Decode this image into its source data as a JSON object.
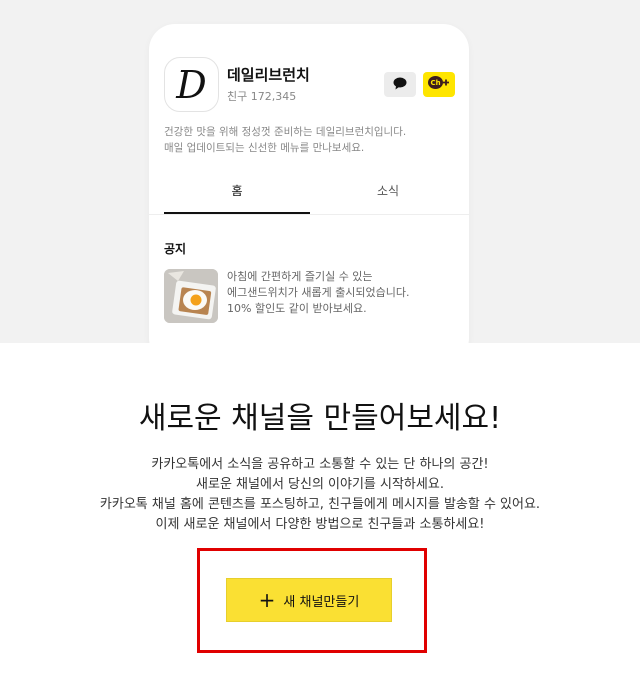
{
  "preview": {
    "logo_letter": "D",
    "profile": {
      "name": "데일리브런치",
      "friends": "친구 172,345"
    },
    "description": [
      "건강한 맛을 위해 정성껏 준비하는 데일리브런치입니다.",
      "매일 업데이트되는 신선한 메뉴를 만나보세요."
    ],
    "tabs": {
      "home": "홈",
      "news": "소식"
    },
    "notice": {
      "title": "공지",
      "lines": [
        "아침에 간편하게 즐기실 수 있는",
        "에그샌드위치가 새롭게 출시되었습니다.",
        "10% 할인도 같이 받아보세요."
      ]
    },
    "ch_badge": "Ch"
  },
  "main": {
    "headline": "새로운 채널을 만들어보세요!",
    "sub_lines": [
      "카카오톡에서 소식을 공유하고 소통할 수 있는 단 하나의 공간!",
      "새로운 채널에서 당신의 이야기를 시작하세요.",
      "카카오톡 채널 홈에 콘텐츠를 포스팅하고, 친구들에게 메시지를 발송할 수 있어요.",
      "이제 새로운 채널에서 다양한 방법으로 친구들과 소통하세요!"
    ],
    "create_button": {
      "plus": "+",
      "label": "새 채널만들기"
    }
  },
  "colors": {
    "kakao_yellow": "#fee500",
    "highlight_red": "#e00000",
    "top_band_bg": "#f2f2f2"
  }
}
